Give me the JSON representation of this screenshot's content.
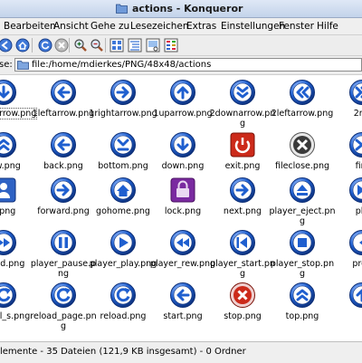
{
  "window": {
    "title": "actions - Konqueror",
    "title_icon": "folder-icon"
  },
  "menu": [
    {
      "label": "Bearbeiten"
    },
    {
      "label": "Ansicht"
    },
    {
      "label": "Gehe zu"
    },
    {
      "label": "Lesezeichen"
    },
    {
      "label": "Extras"
    },
    {
      "label": "Einstellungen"
    },
    {
      "label": "Fenster"
    },
    {
      "label": "Hilfe"
    }
  ],
  "toolbar": [
    {
      "icon": "back-icon"
    },
    {
      "icon": "home-icon"
    },
    {
      "icon": "reload-icon"
    },
    {
      "icon": "stop-icon"
    },
    {
      "icon": "zoom-in-icon"
    },
    {
      "icon": "zoom-out-icon"
    },
    {
      "icon": "icon-view-icon"
    },
    {
      "icon": "tree-view-icon"
    },
    {
      "icon": "preview-icon"
    },
    {
      "icon": "multicolumn-view-icon"
    }
  ],
  "address": {
    "label": "se:",
    "value": "file:/home/mdierkes/PNG/48x48/actions"
  },
  "colors": {
    "icon_blue": "#1f5fcf",
    "icon_red": "#cc2a1a",
    "icon_purple": "#7a2aa0",
    "icon_gray": "#6a6a6a"
  },
  "files": [
    {
      "label": "downarrow.png",
      "icon": "1downarrow-icon",
      "selected": true
    },
    {
      "label": "1leftarrow.png",
      "icon": "1leftarrow-icon"
    },
    {
      "label": "1rightarrow.png",
      "icon": "1rightarrow-icon"
    },
    {
      "label": "1uparrow.png",
      "icon": "1uparrow-icon"
    },
    {
      "label": "2downarrow.png",
      "icon": "2downarrow-icon"
    },
    {
      "label": "2leftarrow.png",
      "icon": "2leftarrow-icon"
    },
    {
      "label": "2rig",
      "icon": "2rightarrow-icon"
    },
    {
      "label": "row.png",
      "icon": "2uparrow-icon"
    },
    {
      "label": "back.png",
      "icon": "back-icon"
    },
    {
      "label": "bottom.png",
      "icon": "bottom-icon"
    },
    {
      "label": "down.png",
      "icon": "down-icon"
    },
    {
      "label": "exit.png",
      "icon": "exit-icon"
    },
    {
      "label": "fileclose.png",
      "icon": "fileclose-icon"
    },
    {
      "label": "fini",
      "icon": "finish-icon"
    },
    {
      "label": "k.png",
      "icon": "user-icon"
    },
    {
      "label": "forward.png",
      "icon": "forward-icon"
    },
    {
      "label": "gohome.png",
      "icon": "gohome-icon"
    },
    {
      "label": "lock.png",
      "icon": "lock-icon"
    },
    {
      "label": "next.png",
      "icon": "next-icon"
    },
    {
      "label": "player_eject.png",
      "icon": "player-eject-icon"
    },
    {
      "label": "pla",
      "icon": "player-end-icon"
    },
    {
      "label": "r_fwd.png",
      "icon": "player-fwd-icon"
    },
    {
      "label": "player_pause.png",
      "icon": "player-pause-icon"
    },
    {
      "label": "player_play.png",
      "icon": "player-play-icon"
    },
    {
      "label": "player_rew.png",
      "icon": "player-rew-icon"
    },
    {
      "label": "player_start.png",
      "icon": "player-start-icon"
    },
    {
      "label": "player_stop.png",
      "icon": "player-stop-icon"
    },
    {
      "label": "prev",
      "icon": "previous-icon"
    },
    {
      "label": "ad_all_s.png",
      "icon": "reload-all-icon"
    },
    {
      "label": "reload_page.png",
      "icon": "reload-page-icon"
    },
    {
      "label": "reload.png",
      "icon": "reload-icon"
    },
    {
      "label": "start.png",
      "icon": "start-icon"
    },
    {
      "label": "stop.png",
      "icon": "stop-icon"
    },
    {
      "label": "top.png",
      "icon": "top-icon"
    },
    {
      "label": "",
      "icon": "up-icon"
    }
  ],
  "status": {
    "text": "lemente - 35 Dateien (121,9 KB insgesamt) - 0 Ordner"
  }
}
